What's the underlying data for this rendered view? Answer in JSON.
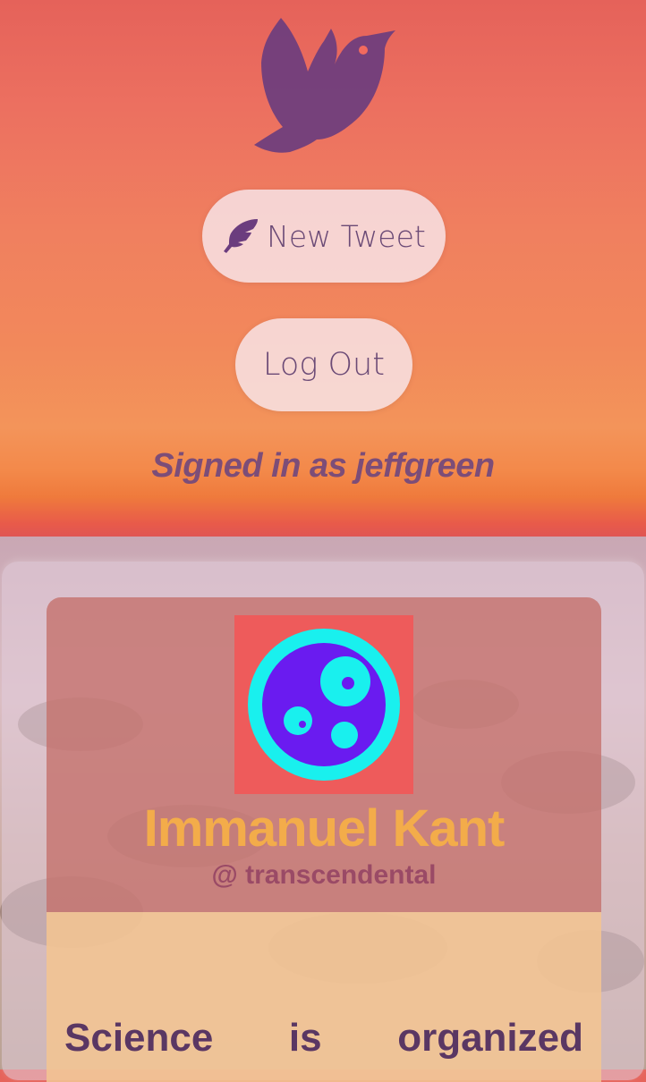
{
  "toolbar": {
    "new_tweet_label": "New Tweet",
    "log_out_label": "Log Out"
  },
  "session": {
    "signed_in_text": "Signed in as jeffgreen"
  },
  "icons": {
    "logo": "dove-icon",
    "new_tweet": "feather-icon"
  },
  "profile": {
    "name": "Immanuel Kant",
    "handle": "@ transcendental"
  },
  "tweet": {
    "words": [
      "Science",
      "is",
      "organized"
    ]
  },
  "colors": {
    "accent_purple": "#6b3d7e",
    "name_orange": "#f3ac4a",
    "handle_rose": "#9a4a66",
    "avatar_bg": "#ee5b5b",
    "avatar_ring": "#19f0ee",
    "avatar_core": "#6a1bf0"
  }
}
